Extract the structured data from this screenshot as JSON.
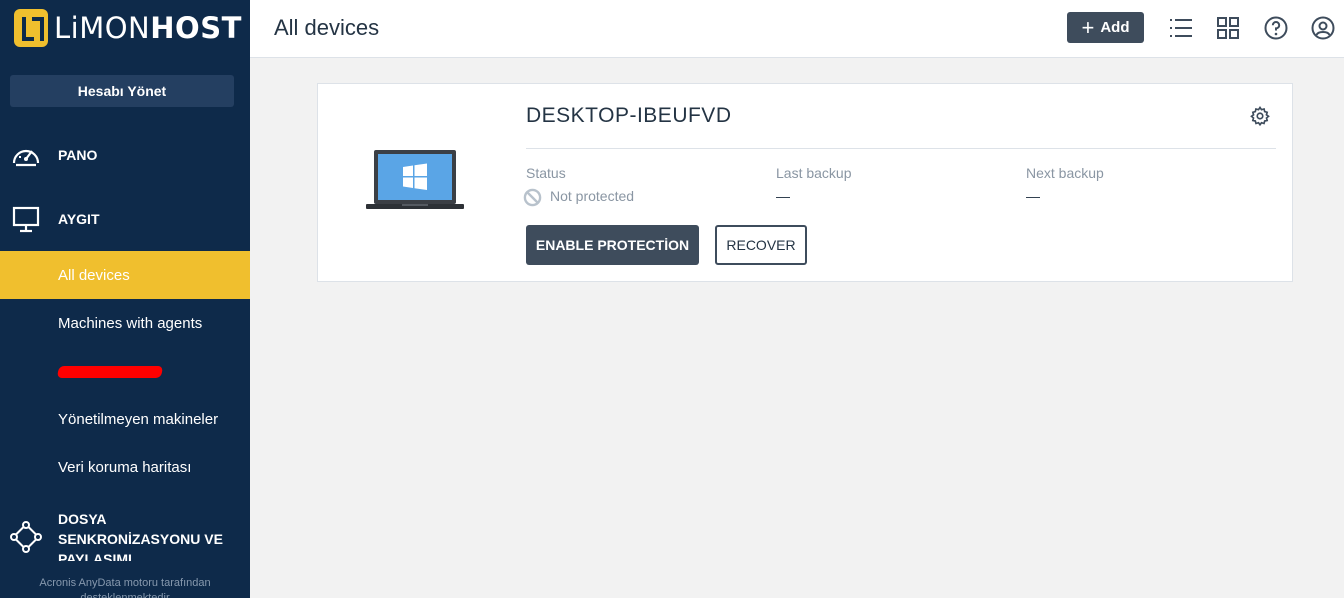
{
  "brand": {
    "name_light": "LiMON",
    "name_bold": "HOST"
  },
  "sidebar": {
    "manage_account": "Hesabı Yönet",
    "sections": {
      "pano": "PANO",
      "aygit": "AYGIT",
      "sync": "DOSYA SENKRONİZASYONU VE PAYLAŞIMI"
    },
    "items": [
      {
        "label": "All devices",
        "active": true
      },
      {
        "label": "Machines with agents",
        "active": false
      },
      {
        "label": "Yönetilmeyen makineler",
        "active": false
      },
      {
        "label": "Veri koruma haritası",
        "active": false
      }
    ],
    "footer": "Acronis AnyData motoru tarafından desteklenmektedir"
  },
  "header": {
    "title": "All devices",
    "add_label": "Add",
    "icons": [
      "list-view-icon",
      "grid-view-icon",
      "help-icon",
      "user-account-icon"
    ]
  },
  "device": {
    "name": "DESKTOP-IBEUFVD",
    "status_label": "Status",
    "status_value": "Not protected",
    "last_backup_label": "Last backup",
    "last_backup_value": "—",
    "next_backup_label": "Next backup",
    "next_backup_value": "—",
    "enable_label": "ENABLE PROTECTİON",
    "recover_label": "RECOVER"
  },
  "colors": {
    "sidebar": "#0e2a4a",
    "accent": "#f0bf2e",
    "button": "#3e4c5c",
    "background": "#f2f2f2"
  }
}
